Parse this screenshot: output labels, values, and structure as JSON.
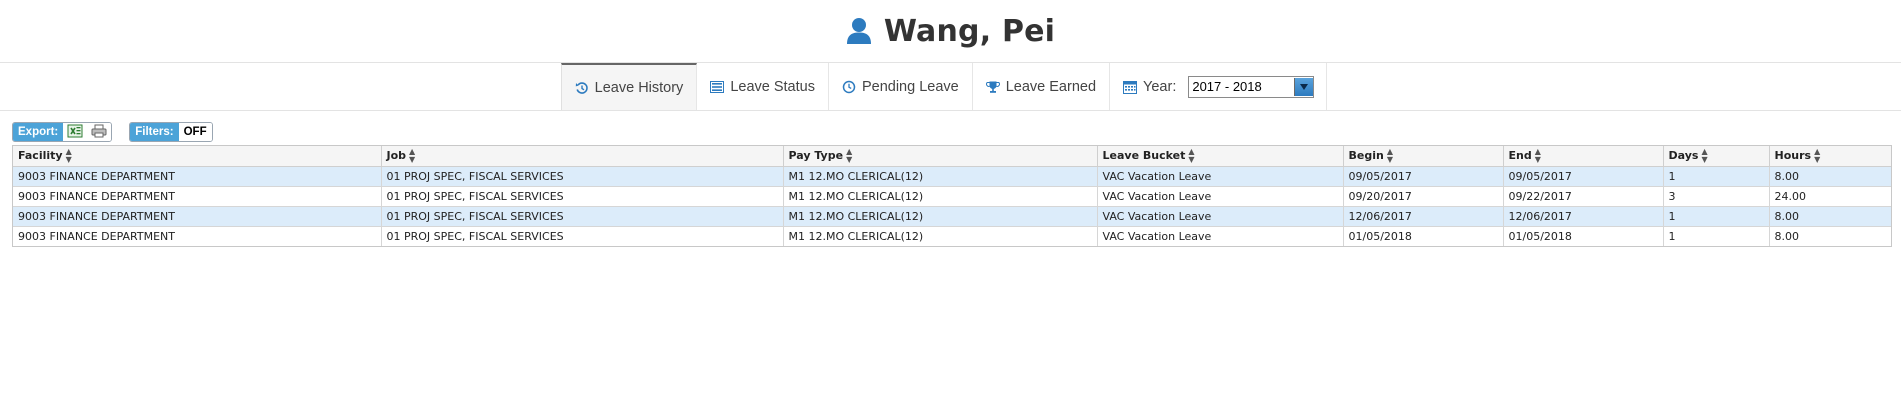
{
  "header": {
    "name": "Wang, Pei",
    "icon": "user-icon"
  },
  "tabs": {
    "leave_history": "Leave History",
    "leave_status": "Leave Status",
    "pending_leave": "Pending Leave",
    "leave_earned": "Leave Earned",
    "year_label": "Year:",
    "year_value": "2017 - 2018"
  },
  "toolbar": {
    "export_label": "Export:",
    "filters_label": "Filters:",
    "filters_state": "OFF"
  },
  "table": {
    "columns": [
      "Facility",
      "Job",
      "Pay Type",
      "Leave Bucket",
      "Begin",
      "End",
      "Days",
      "Hours"
    ],
    "rows": [
      [
        "9003 FINANCE DEPARTMENT",
        "01 PROJ SPEC, FISCAL SERVICES",
        "M1 12.MO CLERICAL(12)",
        "VAC Vacation Leave",
        "09/05/2017",
        "09/05/2017",
        "1",
        "8.00"
      ],
      [
        "9003 FINANCE DEPARTMENT",
        "01 PROJ SPEC, FISCAL SERVICES",
        "M1 12.MO CLERICAL(12)",
        "VAC Vacation Leave",
        "09/20/2017",
        "09/22/2017",
        "3",
        "24.00"
      ],
      [
        "9003 FINANCE DEPARTMENT",
        "01 PROJ SPEC, FISCAL SERVICES",
        "M1 12.MO CLERICAL(12)",
        "VAC Vacation Leave",
        "12/06/2017",
        "12/06/2017",
        "1",
        "8.00"
      ],
      [
        "9003 FINANCE DEPARTMENT",
        "01 PROJ SPEC, FISCAL SERVICES",
        "M1 12.MO CLERICAL(12)",
        "VAC Vacation Leave",
        "01/05/2018",
        "01/05/2018",
        "1",
        "8.00"
      ]
    ]
  },
  "colors": {
    "accent": "#4ca3d8",
    "row_highlight": "#dcecfa",
    "icon_blue": "#2d7bbf"
  }
}
